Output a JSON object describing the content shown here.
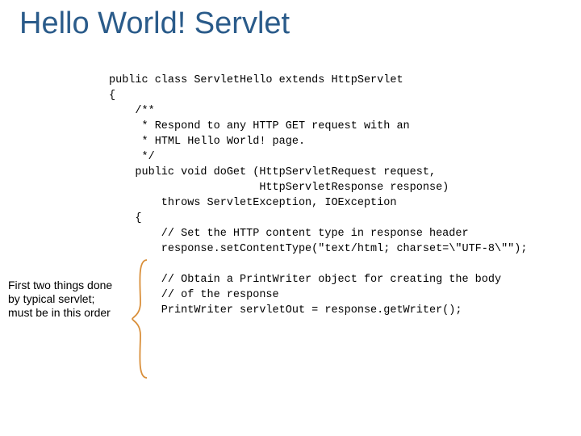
{
  "title": "Hello World! Servlet",
  "code": {
    "l1": "public class ServletHello extends HttpServlet",
    "l2": "{",
    "l3": "    /**",
    "l4": "     * Respond to any HTTP GET request with an",
    "l5": "     * HTML Hello World! page.",
    "l6": "     */",
    "l7": "    public void doGet (HttpServletRequest request,",
    "l8": "                       HttpServletResponse response)",
    "l9": "        throws ServletException, IOException",
    "l10": "    {",
    "l11": "        // Set the HTTP content type in response header",
    "l12": "        response.setContentType(\"text/html; charset=\\\"UTF-8\\\"\");",
    "l13": "",
    "l14": "        // Obtain a PrintWriter object for creating the body",
    "l15": "        // of the response",
    "l16": "        PrintWriter servletOut = response.getWriter();"
  },
  "annotation": "First two things done by typical servlet; must be in this order"
}
